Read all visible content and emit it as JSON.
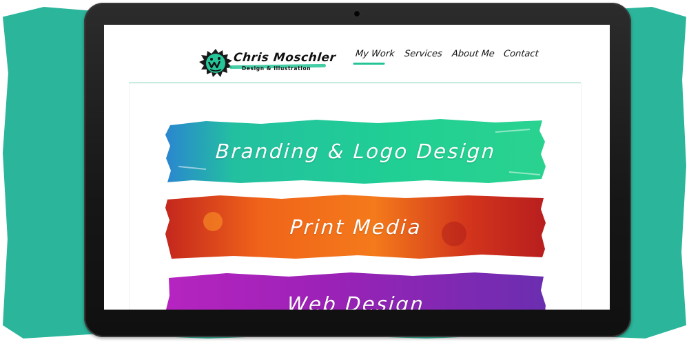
{
  "site": {
    "logo": {
      "name": "Chris Moschler",
      "tagline": "Design & Illustration"
    },
    "nav": [
      {
        "label": "My Work",
        "active": true
      },
      {
        "label": "Services",
        "active": false
      },
      {
        "label": "About Me",
        "active": false
      },
      {
        "label": "Contact",
        "active": false
      }
    ]
  },
  "banners": [
    {
      "label": "Branding & Logo Design",
      "color_a": "#23c997",
      "color_b": "#2a7fd0"
    },
    {
      "label": "Print Media",
      "color_a": "#f5731a",
      "color_b": "#c2261c"
    },
    {
      "label": "Web Design",
      "color_a": "#a423b8",
      "color_b": "#6c2fb0"
    }
  ],
  "colors": {
    "backdrop": "#2bb59b",
    "accent": "#25c497",
    "bezel": "#1a1a1a"
  },
  "icons": {
    "logo_mark": "spiky-monster-face-icon"
  }
}
